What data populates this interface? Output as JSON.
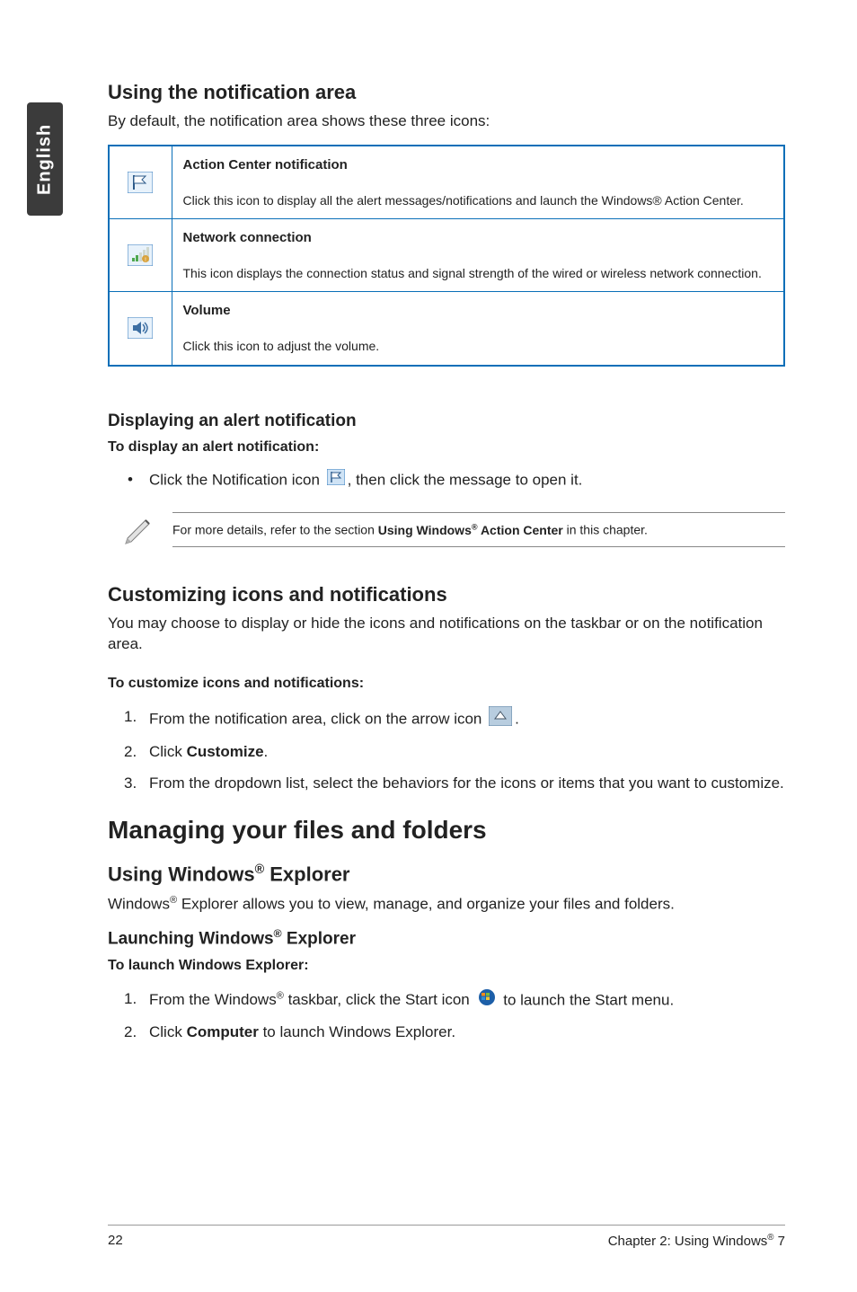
{
  "side_tab": "English",
  "s1": {
    "title": "Using the notification area",
    "intro": "By default, the notification area shows these three icons:",
    "rows": [
      {
        "title": "Action Center notification",
        "desc": "Click this icon to display all the alert messages/notifications and launch the Windows® Action Center."
      },
      {
        "title": "Network connection",
        "desc": "This icon displays the connection status and signal strength of the wired or wireless network connection."
      },
      {
        "title": "Volume",
        "desc": "Click this icon to adjust the volume."
      }
    ]
  },
  "s2": {
    "title": "Displaying an alert notification",
    "sub": "To display an alert notification:",
    "bullet_pre": "Click the Notification icon ",
    "bullet_post": ", then click the message to open it.",
    "note_pre": "For more details, refer to the section ",
    "note_strong": "Using Windows® Action Center",
    "note_post": " in this chapter."
  },
  "s3": {
    "title": "Customizing icons and notifications",
    "intro": "You may choose to display or hide the icons and notifications on the taskbar or on the notification area.",
    "sub": "To customize icons and notifications:",
    "step1_pre": "From the notification area, click on the arrow icon ",
    "step1_post": ".",
    "step2_pre": "Click ",
    "step2_strong": "Customize",
    "step2_post": ".",
    "step3": "From the dropdown list, select the behaviors for the icons or items that you want to customize."
  },
  "main_heading": "Managing your files and folders",
  "s4": {
    "title": "Using Windows® Explorer",
    "intro": "Windows® Explorer allows you to view, manage, and organize your files and folders.",
    "sub": "Launching Windows® Explorer",
    "sub2": "To launch Windows Explorer:",
    "step1_pre": "From the Windows® taskbar, click the Start icon ",
    "step1_post": " to launch the Start menu.",
    "step2_pre": "Click ",
    "step2_strong": "Computer",
    "step2_post": " to launch Windows Explorer."
  },
  "footer": {
    "left": "22",
    "right": "Chapter 2: Using Windows® 7"
  }
}
